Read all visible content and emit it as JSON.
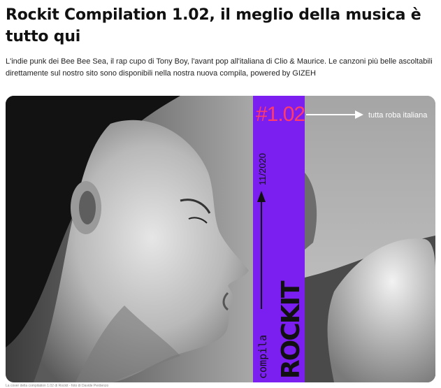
{
  "article": {
    "title": "Rockit Compilation 1.02, il meglio della musica è tutto qui",
    "lead": "L'indie punk dei Bee Bee Sea, il rap cupo di Tony Boy, l'avant pop all'italiana di Clio & Maurice. Le canzoni più belle ascoltabili direttamente sul nostro sito sono disponibili nella nostra nuova compila, powered by GIZEH",
    "caption": "La cover della compilation 1.02 di Rockit - foto di Davide Perdenzo"
  },
  "cover": {
    "number": "#1.02",
    "tagline": "tutta roba italiana",
    "date": "11/2020",
    "compila_word": "compila",
    "brand": "ROCKIT",
    "colors": {
      "band": "#7a1ff0",
      "number": "#ff3b6b",
      "photo_dark": "#1a1a1a",
      "photo_light": "#d9d9d9"
    }
  }
}
